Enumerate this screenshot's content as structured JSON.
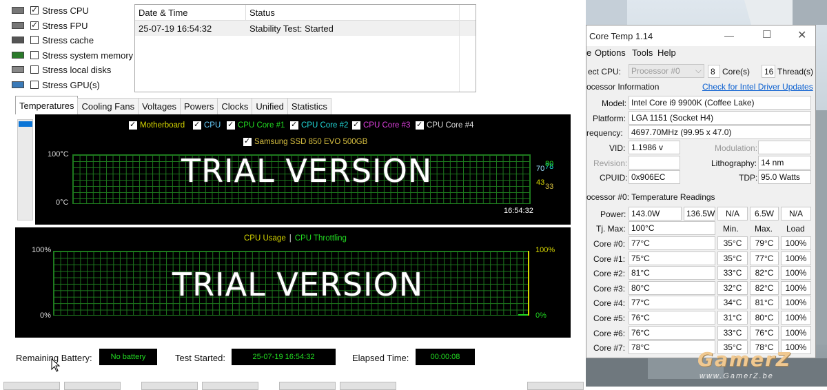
{
  "stress_options": [
    {
      "label": "Stress CPU",
      "checked": true,
      "icon": "cpu-icon"
    },
    {
      "label": "Stress FPU",
      "checked": true,
      "icon": "fpu-icon"
    },
    {
      "label": "Stress cache",
      "checked": false,
      "icon": "cache-icon"
    },
    {
      "label": "Stress system memory",
      "checked": false,
      "icon": "memory-icon"
    },
    {
      "label": "Stress local disks",
      "checked": false,
      "icon": "disk-icon"
    },
    {
      "label": "Stress GPU(s)",
      "checked": false,
      "icon": "gpu-icon"
    }
  ],
  "log": {
    "headers": [
      "Date & Time",
      "Status"
    ],
    "rows": [
      [
        "25-07-19 16:54:32",
        "Stability Test: Started"
      ]
    ]
  },
  "tabs": [
    "Temperatures",
    "Cooling Fans",
    "Voltages",
    "Powers",
    "Clocks",
    "Unified",
    "Statistics"
  ],
  "temp_graph": {
    "legend": [
      {
        "label": "Motherboard",
        "color": "#d8d800"
      },
      {
        "label": "CPU",
        "color": "#6ad0ff"
      },
      {
        "label": "CPU Core #1",
        "color": "#22dd22"
      },
      {
        "label": "CPU Core #2",
        "color": "#22dddd"
      },
      {
        "label": "CPU Core #3",
        "color": "#e040e0"
      },
      {
        "label": "CPU Core #4",
        "color": "#dddddd"
      },
      {
        "label": "Samsung SSD 850 EVO 500GB",
        "color": "#d8c040"
      }
    ],
    "y_top": "100°C",
    "y_bottom": "0°C",
    "time": "16:54:32",
    "readouts": [
      {
        "text": "70",
        "color": "#9fe0ff"
      },
      {
        "text": "78",
        "color": "#22dddd"
      },
      {
        "text": "80",
        "color": "#22dd22"
      },
      {
        "text": "43",
        "color": "#d8d800"
      },
      {
        "text": "33",
        "color": "#d8c040"
      }
    ],
    "watermark": "TRIAL VERSION"
  },
  "usage_graph": {
    "legend_a": "CPU Usage",
    "legend_sep": "|",
    "legend_b": "CPU Throttling",
    "y_top": "100%",
    "y_bottom": "0%",
    "right_top": "100%",
    "right_bottom": "0%",
    "watermark": "TRIAL VERSION"
  },
  "status_bar": {
    "battery_label": "Remaining Battery:",
    "battery_value": "No battery",
    "started_label": "Test Started:",
    "started_value": "25-07-19 16:54:32",
    "elapsed_label": "Elapsed Time:",
    "elapsed_value": "00:00:08"
  },
  "coretemp": {
    "title": "Core Temp 1.14",
    "menu": [
      "Options",
      "Tools",
      "Help"
    ],
    "menu_partial": "e",
    "select_cpu_label": "ect CPU:",
    "processor": "Processor #0",
    "cores": "8",
    "cores_label": "Core(s)",
    "threads": "16",
    "threads_label": "Thread(s)",
    "proc_info_label": "ocessor Information",
    "driver_link": "Check for Intel Driver Updates",
    "model_label": "Model:",
    "model": "Intel Core i9 9900K (Coffee Lake)",
    "platform_label": "Platform:",
    "platform": "LGA 1151 (Socket H4)",
    "freq_label": "requency:",
    "freq": "4697.70MHz (99.95 x 47.0)",
    "vid_label": "VID:",
    "vid": "1.1986 v",
    "modulation_label": "Modulation:",
    "revision_label": "Revision:",
    "litho_label": "Lithography:",
    "litho": "14 nm",
    "cpuid_label": "CPUID:",
    "cpuid": "0x906EC",
    "tdp_label": "TDP:",
    "tdp": "95.0 Watts",
    "temps_header": "ocessor #0: Temperature Readings",
    "power_label": "Power:",
    "power": [
      "143.0W",
      "136.5W",
      "N/A",
      "6.5W",
      "N/A"
    ],
    "tjmax_label": "Tj. Max:",
    "tjmax": "100°C",
    "col_min": "Min.",
    "col_max": "Max.",
    "col_load": "Load",
    "cores_list": [
      {
        "name": "Core #0:",
        "temp": "77°C",
        "min": "35°C",
        "max": "79°C",
        "load": "100%"
      },
      {
        "name": "Core #1:",
        "temp": "75°C",
        "min": "35°C",
        "max": "77°C",
        "load": "100%"
      },
      {
        "name": "Core #2:",
        "temp": "81°C",
        "min": "33°C",
        "max": "82°C",
        "load": "100%"
      },
      {
        "name": "Core #3:",
        "temp": "80°C",
        "min": "32°C",
        "max": "82°C",
        "load": "100%"
      },
      {
        "name": "Core #4:",
        "temp": "77°C",
        "min": "34°C",
        "max": "81°C",
        "load": "100%"
      },
      {
        "name": "Core #5:",
        "temp": "76°C",
        "min": "31°C",
        "max": "80°C",
        "load": "100%"
      },
      {
        "name": "Core #6:",
        "temp": "76°C",
        "min": "33°C",
        "max": "76°C",
        "load": "100%"
      },
      {
        "name": "Core #7:",
        "temp": "78°C",
        "min": "35°C",
        "max": "78°C",
        "load": "100%"
      }
    ]
  },
  "watermark": {
    "brand": "GamerZ",
    "url": "www.GamerZ.be"
  }
}
